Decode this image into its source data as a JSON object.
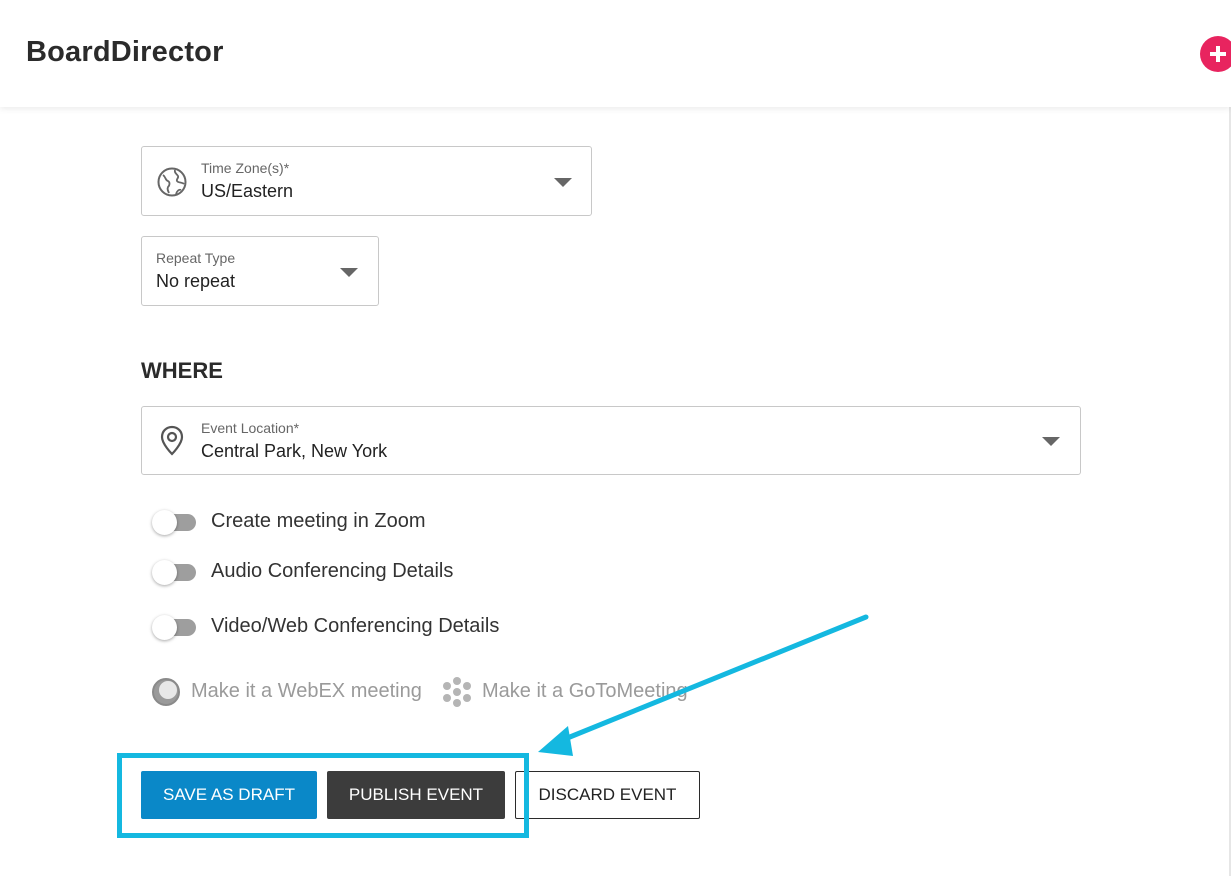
{
  "app": {
    "title": "BoardDirector"
  },
  "header": {
    "add_icon": "plus-icon",
    "add_color": "#e8245f"
  },
  "time_zone": {
    "label": "Time Zone(s)*",
    "value": "US/Eastern",
    "icon": "globe-icon"
  },
  "repeat_type": {
    "label": "Repeat Type",
    "value": "No repeat"
  },
  "where": {
    "title": "WHERE",
    "location": {
      "label": "Event Location*",
      "value": "Central Park, New York",
      "icon": "location-pin-icon"
    }
  },
  "toggles": [
    {
      "label": "Create meeting in Zoom",
      "on": false
    },
    {
      "label": "Audio Conferencing Details",
      "on": false
    },
    {
      "label": "Video/Web Conferencing Details",
      "on": false
    }
  ],
  "meeting_options": [
    {
      "label": "Make it a WebEX meeting",
      "icon": "webex-icon"
    },
    {
      "label": "Make it a GoToMeeting",
      "icon": "gotomeeting-icon"
    }
  ],
  "actions": {
    "save_draft": "SAVE AS DRAFT",
    "publish": "PUBLISH EVENT",
    "discard": "DISCARD EVENT"
  },
  "colors": {
    "accent_blue": "#0a88c8",
    "dark_button": "#3c3c3c",
    "annotation": "#14b8e0"
  }
}
